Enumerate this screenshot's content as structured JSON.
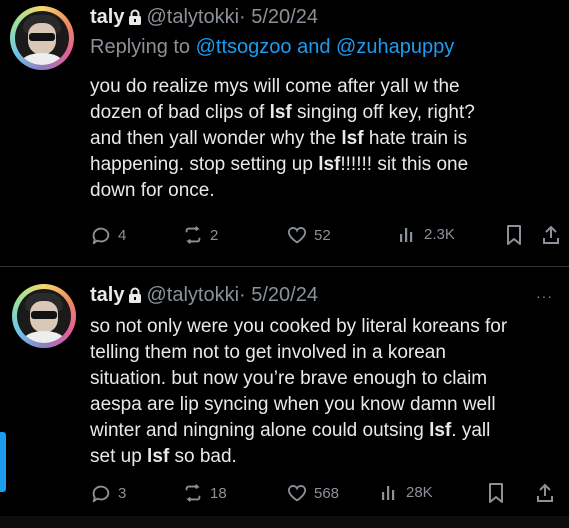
{
  "tweets": [
    {
      "name": "taly",
      "handle": "@talytokki",
      "date": "· 5/20/24",
      "reply_prefix": "Replying to ",
      "reply_mention1": "@ttsogzoo",
      "reply_and": " and ",
      "reply_mention2": "@zuhapuppy",
      "lines": [
        [
          "you do realize mys will come after yall w the"
        ],
        [
          "dozen of bad clips of ",
          {
            "b": "lsf"
          },
          " singing off key, right?"
        ],
        [
          "and then yall wonder why the ",
          {
            "b": "lsf"
          },
          " hate train is"
        ],
        [
          "happening. stop setting up ",
          {
            "b": "lsf"
          },
          "!!!!!! sit this one"
        ],
        [
          "down for once."
        ]
      ],
      "replies": "4",
      "retweets": "2",
      "likes": "52",
      "views": "2.3K"
    },
    {
      "name": "taly",
      "handle": "@talytokki",
      "date": "· 5/20/24",
      "more": "···",
      "lines": [
        [
          "so not only were you cooked by literal koreans for"
        ],
        [
          "telling them not to get involved in a korean"
        ],
        [
          "situation. but now you’re brave enough to claim"
        ],
        [
          "aespa are lip syncing when you know damn well"
        ],
        [
          "winter and ningning alone could outsing ",
          {
            "b": "lsf"
          },
          ". yall"
        ],
        [
          "set up ",
          {
            "b": "lsf"
          },
          " so bad."
        ]
      ],
      "replies": "3",
      "retweets": "18",
      "likes": "568",
      "views": "28K"
    }
  ],
  "colors": {
    "background": "#000000",
    "text": "#e7e9ea",
    "secondary": "#8b9198",
    "link": "#1d9bf0"
  },
  "icons": [
    "lock-icon",
    "reply-icon",
    "retweet-icon",
    "like-icon",
    "views-icon",
    "bookmark-icon",
    "share-icon",
    "more-icon"
  ]
}
